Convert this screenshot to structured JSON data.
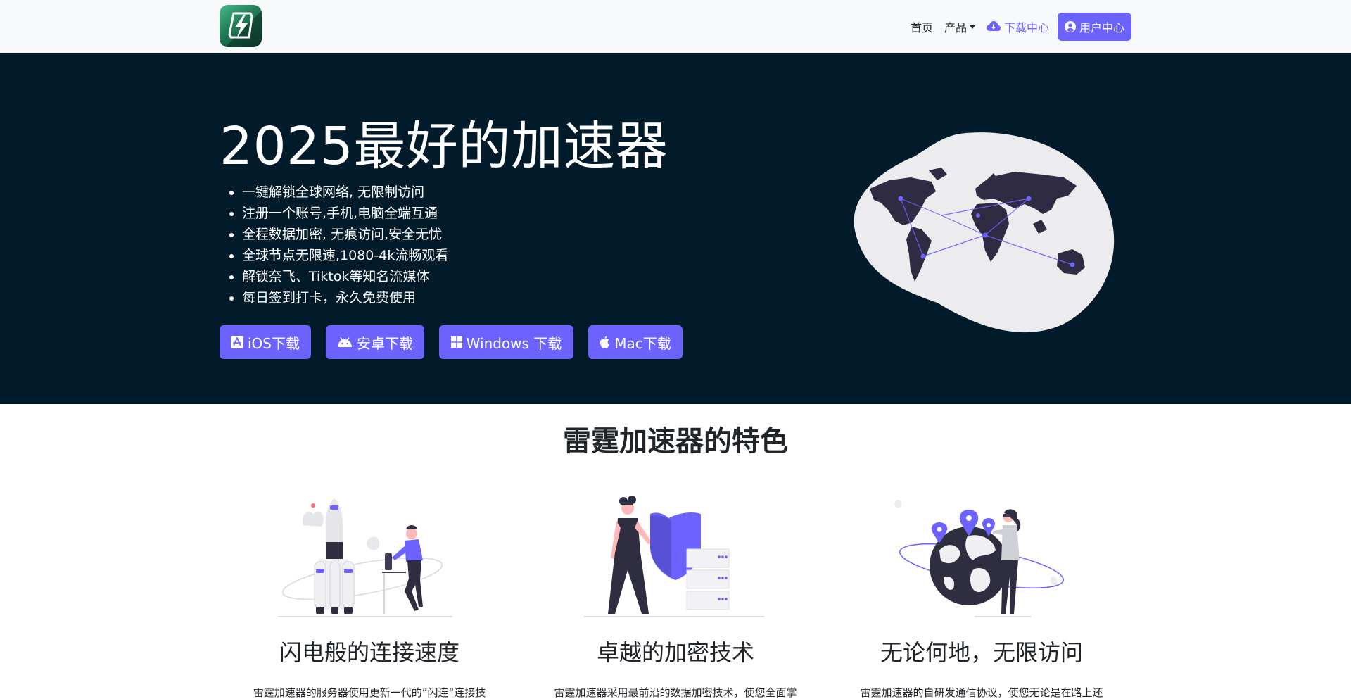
{
  "nav": {
    "logo": "lightning-logo",
    "links": [
      {
        "label": "首页"
      },
      {
        "label": "产品"
      },
      {
        "label": "下载中心",
        "icon": "cloud-download-icon"
      }
    ],
    "user_button": {
      "label": "用户中心",
      "icon": "user-circle-icon"
    }
  },
  "hero": {
    "title": "2025最好的加速器",
    "bullets": [
      "一键解锁全球网络, 无限制访问",
      "注册一个账号,手机,电脑全端互通",
      "全程数据加密, 无痕访问,安全无忧",
      "全球节点无限速,1080-4k流畅观看",
      "解锁奈飞、Tiktok等知名流媒体",
      "每日签到打卡，永久免费使用"
    ],
    "downloads": [
      {
        "label": "iOS下载",
        "icon": "app-store-icon"
      },
      {
        "label": "安卓下载",
        "icon": "android-icon"
      },
      {
        "label": "Windows 下载",
        "icon": "windows-icon"
      },
      {
        "label": "Mac下载",
        "icon": "apple-icon"
      }
    ]
  },
  "features": {
    "title": "雷霆加速器的特色",
    "items": [
      {
        "title": "闪电般的连接速度",
        "desc": "雷霆加速器的服务器使用更新一代的”闪连“连接技"
      },
      {
        "title": "卓越的加密技术",
        "desc": "雷霆加速器采用最前沿的数据加密技术，使您全面掌"
      },
      {
        "title": "无论何地，无限访问",
        "desc": "雷霆加速器的自研发通信协议，使您无论是在路上还"
      }
    ]
  },
  "colors": {
    "accent": "#6c63ff",
    "hero_bg": "#021b2b",
    "nav_bg": "#f8f9fa"
  }
}
